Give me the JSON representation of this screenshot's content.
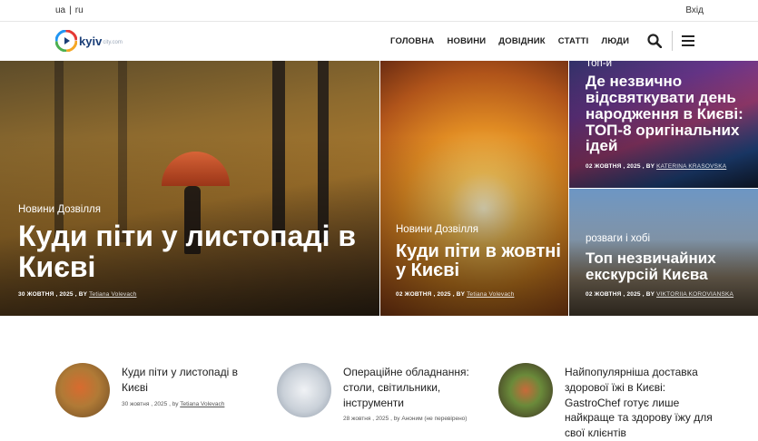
{
  "header": {
    "lang_ua": "ua",
    "lang_sep": "|",
    "lang_ru": "ru",
    "login": "Вхід"
  },
  "logo": {
    "text": "kyiv",
    "sub": "city.com"
  },
  "nav": {
    "items": [
      "ГОЛОВНА",
      "НОВИНИ",
      "ДОВІДНИК",
      "СТАТТІ",
      "ЛЮДИ"
    ]
  },
  "hero": [
    {
      "category": "Новини Дозвілля",
      "title": "Куди піти у листопаді в Києві",
      "date": "30 ЖОВТНЯ , 2025 , BY",
      "author": "Tetiana Volevach"
    },
    {
      "category": "Новини Дозвілля",
      "title": "Куди піти в жовтні у Києві",
      "date": "02 ЖОВТНЯ , 2025 , BY",
      "author": "Tetiana Volevach"
    },
    {
      "category": "Топ-и",
      "title": "Де незвично відсвяткувати день народження в Києві: ТОП-8 оригінальних ідей",
      "date": "02 ЖОВТНЯ , 2025 , BY",
      "author": "KATERINA KRASOVSKA"
    },
    {
      "category": "розваги і хобі",
      "title": "Топ незвичайних екскурсій Києва",
      "date": "02 ЖОВТНЯ , 2025 , BY",
      "author": "VIKTORIIA KOROVIANSKA"
    }
  ],
  "articles": [
    {
      "title": "Куди піти у листопаді в Києві",
      "date": "30 жовтня , 2025 , by",
      "author": "Tetiana Volevach"
    },
    {
      "title": "Операційне обладнання: столи, світильники, інструменти",
      "date": "28 жовтня , 2025 , by Аноним (не перевірено)",
      "author": ""
    },
    {
      "title": "Найпопулярніша доставка здорової їжі в Києві: GastroChef готує лише найкраще та здорову їжу для свої клієнтів",
      "date": "",
      "author": ""
    }
  ],
  "colors": {
    "brand": "#1a3e77",
    "text": "#222222"
  }
}
